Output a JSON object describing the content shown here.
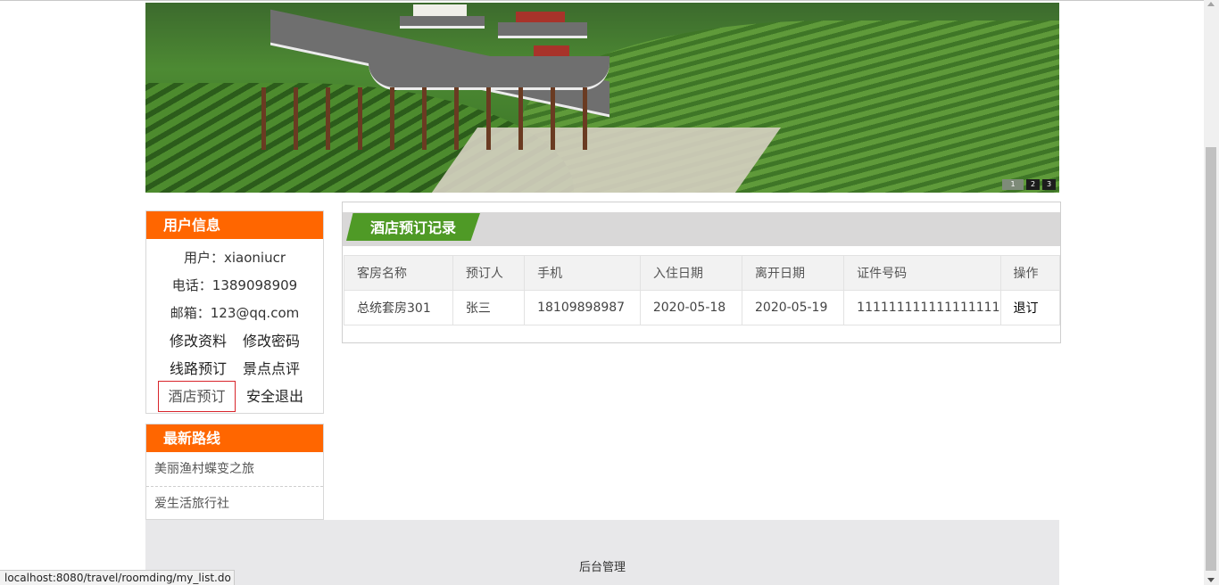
{
  "banner": {
    "slides": [
      "1",
      "2",
      "3"
    ],
    "active_slide": 1
  },
  "user_info": {
    "title": "用户信息",
    "user": "用户：xiaoniucr",
    "phone": "电话：1389098909",
    "email": "邮箱：123@qq.com",
    "links": {
      "edit_profile": "修改资料",
      "change_password": "修改密码",
      "route_booking": "线路预订",
      "attraction_review": "景点点评",
      "hotel_booking": "酒店预订",
      "logout": "安全退出"
    }
  },
  "latest_routes": {
    "title": "最新路线",
    "items": [
      "美丽渔村蝶变之旅",
      "爱生活旅行社"
    ]
  },
  "records": {
    "title": "酒店预订记录",
    "columns": [
      "客房名称",
      "预订人",
      "手机",
      "入住日期",
      "离开日期",
      "证件号码",
      "操作"
    ],
    "rows": [
      [
        "总统套房301",
        "张三",
        "18109898987",
        "2020-05-18",
        "2020-05-19",
        "111111111111111111",
        "退订"
      ]
    ]
  },
  "footer": {
    "admin_link": "后台管理"
  },
  "status_bar": {
    "url": "localhost:8080/travel/roomding/my_list.do"
  }
}
